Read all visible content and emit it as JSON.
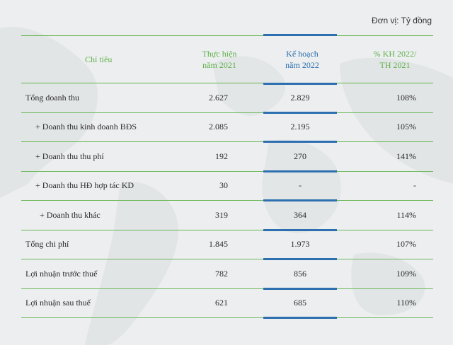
{
  "unit_label": "Đơn vị: Tỷ đồng",
  "header": {
    "col0": "Chỉ tiêu",
    "col1": "Thực hiện\nnăm 2021",
    "col2": "Kế hoạch\nnăm 2022",
    "col3": "% KH 2022/\nTH 2021"
  },
  "rows": [
    {
      "label": "Tổng doanh thu",
      "actual_2021": "2.627",
      "plan_2022": "2.829",
      "ratio": "108%"
    },
    {
      "label": "+ Doanh thu kinh doanh BĐS",
      "actual_2021": "2.085",
      "plan_2022": "2.195",
      "ratio": "105%"
    },
    {
      "label": "+ Doanh thu thu phí",
      "actual_2021": "192",
      "plan_2022": "270",
      "ratio": "141%"
    },
    {
      "label": "+ Doanh thu HĐ hợp tác KD",
      "actual_2021": "30",
      "plan_2022": "-",
      "ratio": "-"
    },
    {
      "label": "+ Doanh thu khác",
      "actual_2021": "319",
      "plan_2022": "364",
      "ratio": "114%"
    },
    {
      "label": "Tổng chi phí",
      "actual_2021": "1.845",
      "plan_2022": "1.973",
      "ratio": "107%"
    },
    {
      "label": "Lợi nhuận trước thuế",
      "actual_2021": "782",
      "plan_2022": "856",
      "ratio": "109%"
    },
    {
      "label": "Lợi nhuận sau thuế",
      "actual_2021": "621",
      "plan_2022": "685",
      "ratio": "110%"
    }
  ],
  "colors": {
    "green": "#5fb04a",
    "blue": "#2a6fae",
    "rule_green": "#62b34a",
    "rule_blue": "#2e6fb0"
  }
}
